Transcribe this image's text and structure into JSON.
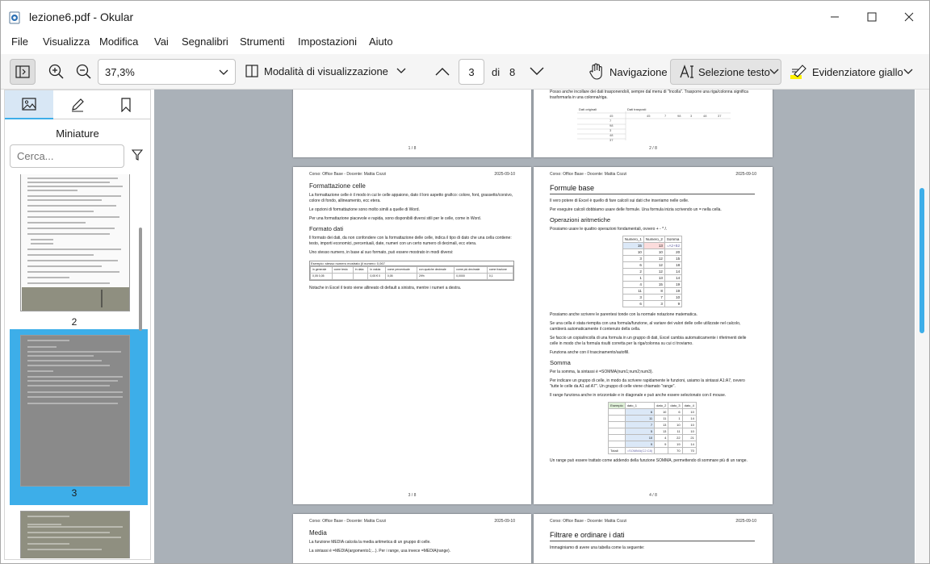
{
  "window": {
    "title": "lezione6.pdf - Okular"
  },
  "menu": [
    "File",
    "Visualizza",
    "Modifica",
    "Vai",
    "Segnalibri",
    "Strumenti",
    "Impostazioni",
    "Aiuto"
  ],
  "toolbar": {
    "zoom": "37,3%",
    "view_mode": "Modalità di visualizzazione",
    "current_page": "3",
    "of_label": "di",
    "total_pages": "8",
    "navigation": "Navigazione",
    "text_select": "Selezione testo",
    "highlighter": "Evidenziatore giallo"
  },
  "sidebar": {
    "title": "Miniature",
    "search_placeholder": "Cerca...",
    "thumb_numbers": [
      "2",
      "3"
    ]
  },
  "pages": {
    "p1_footer": "1 / 8",
    "p2_footer": "2 / 8",
    "p2_top_text": "Posso anche incollare dei dati trasponendoli, sempre dal menu di \"Incolla\". Trasporre una riga/colonna significa trasformarla in una colonna/riga.",
    "p2_table_headers": [
      "Dati originali",
      "Dati trasposti"
    ],
    "p3": {
      "header_left": "Corso: Office Base - Docente: Mattia Cozzi",
      "header_right": "2025-09-10",
      "h1": "Formattazione celle",
      "para1": "La formattazione celle è il modo in cui le celle appaiono, dato il loro aspetto grafico: colore, font, grassetto/corsivo, colore di fondo, allineamento, ecc etera.",
      "para2": "Le opzioni di formattazione sono molto simili a quelle di Word.",
      "para3": "Per una formattazione piacevole e rapida, sono disponibili diversi stili per le celle, come in Word.",
      "h2": "Formato dati",
      "para4": "Il formato dei dati, da non confondere con la formattazione delle celle, indica il tipo di dato che una cella contiene: testo, importi economici, percentuali, date, numeri con un certo numero di decimali, ecc etera.",
      "para5": "Uno stesso numero, in base al suo formato, può essere mostrato in modi diversi:",
      "table_caption": "Esempio: stesso numero mostrato (il numero: 0,067",
      "table_cols": [
        "in generale",
        "come testo",
        "in data",
        "in valuta",
        "come percentuale",
        "con qualche decimale",
        "come più decimale",
        "come frazione"
      ],
      "table_vals": [
        "0,05 0,05",
        "",
        "",
        "0,05 € 0",
        "0,05",
        "29%",
        "0,0000",
        "0,1"
      ],
      "para6": "Notache in Excel il testo viene allineato di default a sinistra, mentre i numeri a destra.",
      "footer": "3 / 8"
    },
    "p4": {
      "header_left": "Corso: Office Base - Docente: Mattia Cozzi",
      "header_right": "2025-09-10",
      "h1": "Formule base",
      "para1": "Il vero potere di Excel è quello di fare calcoli sui dati che inseriamo nelle celle.",
      "para2": "Per eseguire calcoli dobbiamo usare delle formule. Una formula inizia scrivendo un = nella cella.",
      "h2a": "Operazioni aritmetiche",
      "para3": "Possiamo usare le quattro operazioni fondamentali, ovvero + - * /.",
      "table_headers": [
        "Numero_1",
        "Numero_2",
        "Somma"
      ],
      "table_rows": [
        [
          "15",
          "13",
          "=A2+B2"
        ],
        [
          "10",
          "10",
          "20"
        ],
        [
          "3",
          "12",
          "15"
        ],
        [
          "6",
          "12",
          "18"
        ],
        [
          "2",
          "12",
          "14"
        ],
        [
          "1",
          "13",
          "14"
        ],
        [
          "4",
          "15",
          "19"
        ],
        [
          "11",
          "8",
          "19"
        ],
        [
          "3",
          "7",
          "10"
        ],
        [
          "6",
          "3",
          "9"
        ]
      ],
      "para4": "Possiamo anche scrivere le parentesi tonde con la normale notazione matematica.",
      "para5": "Se una cella è stata riempita con una formula/funzione, al variare dei valori delle celle utilizzate nel calcolo, cambierà automaticamente il contenuto della cella.",
      "para6": "Se faccio un copia/incolla di una formula in un gruppo di dati, Excel cambia automaticamente i riferimenti delle celle in modo che la formula risulti corretta per la riga/colonna su cui ci troviamo.",
      "para7": "Funziona anche con il trascinamento/autofill.",
      "h2b": "Somma",
      "para8": "Per la somma, la sintassi è =SOMMA(num1;num2;num3).",
      "para9": "Per indicare un gruppo di celle, in modo da scrivere rapidamente le funzioni, usiamo la sintassi A1:A7, ovvero \"tutte le celle da A1 ad A7\". Un gruppo di celle viene chiamato \"range\".",
      "para10": "Il range funziona anche in orizzontale e in diagonale e può anche essere selezionato con il mouse.",
      "sum_headers": [
        "Esempio",
        "dato_1",
        "dato_2",
        "dato_3",
        "dato_4"
      ],
      "sum_rows": [
        [
          "",
          "6",
          "10",
          "6",
          "10"
        ],
        [
          "",
          "11",
          "11",
          "1",
          "14"
        ],
        [
          "",
          "7",
          "13",
          "10",
          "10"
        ],
        [
          "",
          "5",
          "13",
          "11",
          "10"
        ],
        [
          "",
          "10",
          "4",
          "22",
          "21"
        ],
        [
          "",
          "9",
          "9",
          "19",
          "14"
        ],
        [
          "Totali",
          "=SOMMA(C2:C8)",
          "",
          "70",
          "70"
        ]
      ],
      "para11": "Un range può essere trattato come addendo della funzione SOMMA, permettendo di sommare più di un range.",
      "footer": "4 / 8"
    },
    "p5": {
      "header_left": "Corso: Office Base - Docente: Mattia Cozzi",
      "header_right": "2025-09-10",
      "h1": "Media",
      "para1": "La funzione MEDIA calcola la media aritmetica di un gruppo di celle.",
      "para2": "La sintassi è =MEDIA(argomento1;...). Per i range, usa invece =MEDIA(range)."
    },
    "p6": {
      "header_left": "Corso: Office Base - Docente: Mattia Cozzi",
      "header_right": "2025-09-10",
      "h1": "Filtrare e ordinare i dati",
      "para1": "Immaginiamo di avere una tabella come la seguente:"
    }
  },
  "colors": {
    "accent": "#3daee9",
    "doc_bg": "#aab1b8",
    "highlight": "#fff200"
  }
}
